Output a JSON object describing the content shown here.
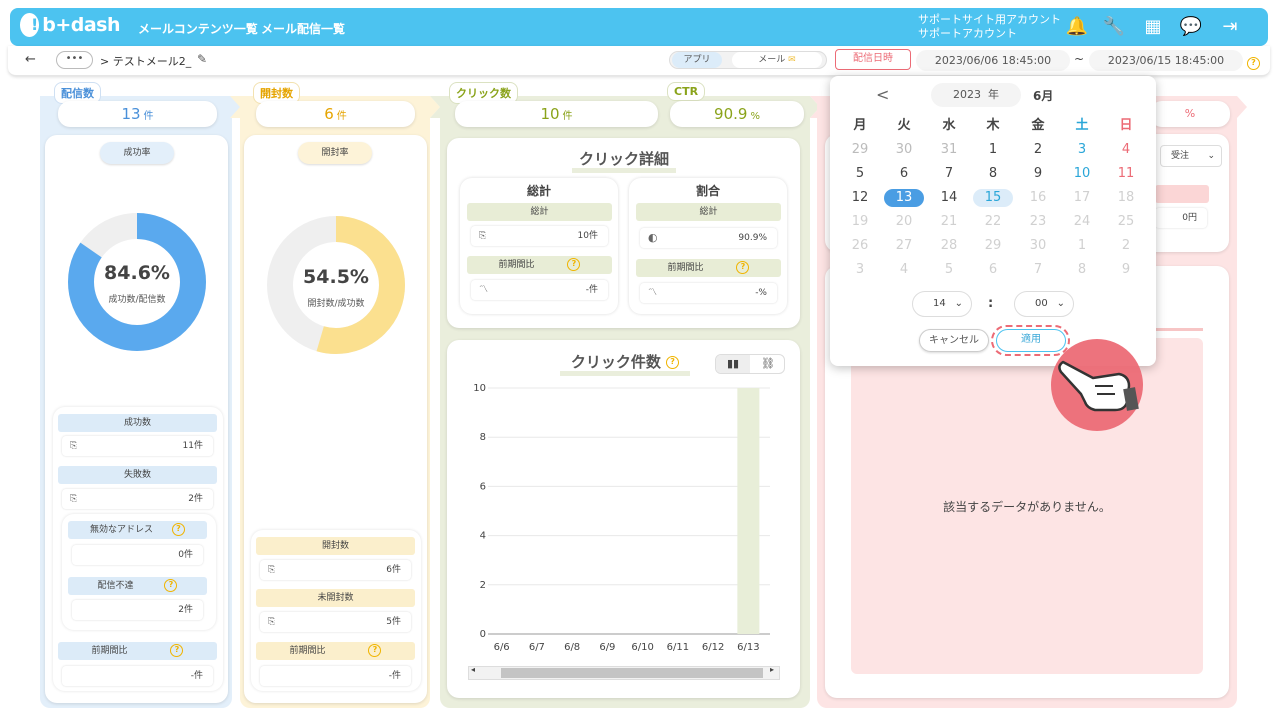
{
  "header": {
    "logo": "b+dash",
    "nav": [
      "メールコンテンツ一覧",
      "メール配信一覧"
    ],
    "account_line1": "サポートサイト用アカウント",
    "account_line2": "サポートアカウント",
    "icons": [
      "bell-icon",
      "wrench-icon",
      "grid-icon",
      "chat-icon",
      "logout-icon"
    ]
  },
  "subbar": {
    "back": "←",
    "more": "•••",
    "breadcrumb": "> テストメール2_",
    "segment": [
      "アプリ",
      "メール"
    ],
    "date_mode": "配信日時",
    "date_from": "2023/06/06 18:45:00",
    "tilde": "~",
    "date_to": "2023/06/15 18:45:00"
  },
  "delivery": {
    "tab": "配信数",
    "count": "13",
    "unit": "件",
    "rate_tag": "成功率",
    "rate": "84.6%",
    "rate_sub": "成功数/配信数",
    "rate_value": 0.846,
    "success_label": "成功数",
    "success": "11件",
    "fail_label": "失敗数",
    "fail": "2件",
    "invalid_label": "無効なアドレス",
    "invalid": "0件",
    "undeliv_label": "配信不達",
    "undeliv": "2件",
    "prev_label": "前期間比",
    "prev": "-件"
  },
  "open": {
    "tab": "開封数",
    "count": "6",
    "unit": "件",
    "rate_tag": "開封率",
    "rate": "54.5%",
    "rate_sub": "開封数/成功数",
    "rate_value": 0.545,
    "opened_label": "開封数",
    "opened": "6件",
    "unopened_label": "未開封数",
    "unopened": "5件",
    "prev_label": "前期間比",
    "prev": "-件"
  },
  "click": {
    "tab": "クリック数",
    "count": "10",
    "unit": "件",
    "ctr_tab": "CTR",
    "ctr": "90.9",
    "ctr_unit": "%",
    "detail_title": "クリック詳細",
    "total_head": "総計",
    "ratio_head": "割合",
    "total_label": "総計",
    "total": "10件",
    "ratio_label": "総計",
    "ratio": "90.9%",
    "prev_label": "前期間比",
    "prev_total": "-件",
    "prev_ratio_label": "前期間比",
    "prev_ratio": "-%",
    "chart_title": "クリック件数"
  },
  "chart_data": {
    "type": "bar",
    "title": "クリック件数",
    "categories": [
      "6/6",
      "6/7",
      "6/8",
      "6/9",
      "6/10",
      "6/11",
      "6/12",
      "6/13"
    ],
    "values": [
      0,
      0,
      0,
      0,
      0,
      0,
      0,
      10
    ],
    "yticks": [
      0,
      2,
      4,
      6,
      8,
      10
    ],
    "ylim": [
      0,
      10
    ],
    "bar_color": "#e8eed8"
  },
  "right_panel": {
    "percent": "%",
    "select": "受注",
    "amount": "0円",
    "empty": "該当するデータがありません。"
  },
  "calendar": {
    "prev": "<",
    "year": "2023",
    "year_unit": "年",
    "month": "6月",
    "weekdays": [
      "月",
      "火",
      "水",
      "木",
      "金",
      "土",
      "日"
    ],
    "weeks": [
      [
        "29",
        "30",
        "31",
        "1",
        "2",
        "3",
        "4"
      ],
      [
        "5",
        "6",
        "7",
        "8",
        "9",
        "10",
        "11"
      ],
      [
        "12",
        "13",
        "14",
        "15",
        "16",
        "17",
        "18"
      ],
      [
        "19",
        "20",
        "21",
        "22",
        "23",
        "24",
        "25"
      ],
      [
        "26",
        "27",
        "28",
        "29",
        "30",
        "1",
        "2"
      ],
      [
        "3",
        "4",
        "5",
        "6",
        "7",
        "8",
        "9"
      ]
    ],
    "hour": "14",
    "colon": ":",
    "minute": "00",
    "cancel": "キャンセル",
    "apply": "適用"
  },
  "colors": {
    "header": "#4cc3f0",
    "blue_col": "#e3effa",
    "yellow_col": "#fdf3d8",
    "green_col": "#eaeedc",
    "pink_col": "#fde4e4",
    "donut_blue": "#5aa9ee",
    "donut_yellow": "#fbe08f",
    "selected_day": "#4a9de3",
    "accent_red": "#ec6b76"
  }
}
